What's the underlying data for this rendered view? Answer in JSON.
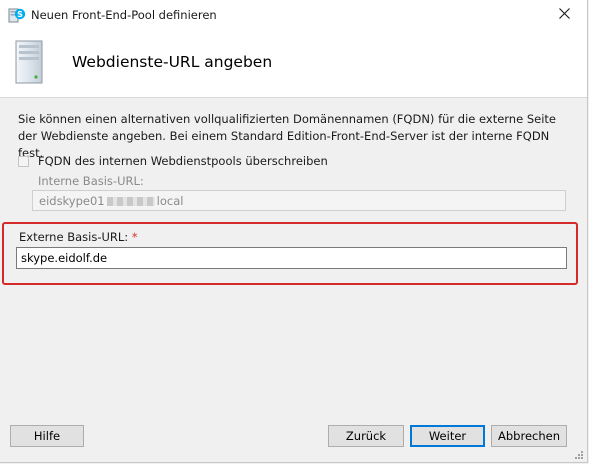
{
  "window": {
    "title": "Neuen Front-End-Pool definieren",
    "app_icon": "skype-server-icon",
    "close_icon": "close-icon"
  },
  "header": {
    "title": "Webdienste-URL angeben",
    "icon": "server-icon"
  },
  "body": {
    "description": "Sie können einen alternativen vollqualifizierten Domänennamen (FQDN) für die externe Seite der Webdienste angeben. Bei einem Standard Edition-Front-End-Server ist der interne FQDN fest.",
    "override_checkbox": {
      "label": "FQDN des internen Webdienstpools überschreiben",
      "checked": false,
      "disabled": true
    },
    "internal_url": {
      "label": "Interne Basis-URL:",
      "value_prefix": "eidskype01",
      "value_suffix": "local",
      "disabled": true
    },
    "external_url": {
      "label": "Externe Basis-URL:",
      "required_marker": "*",
      "value": "skype.eidolf.de"
    },
    "highlight_color": "#d42a2a"
  },
  "buttons": {
    "help": "Hilfe",
    "back": "Zurück",
    "next": "Weiter",
    "cancel": "Abbrechen"
  }
}
